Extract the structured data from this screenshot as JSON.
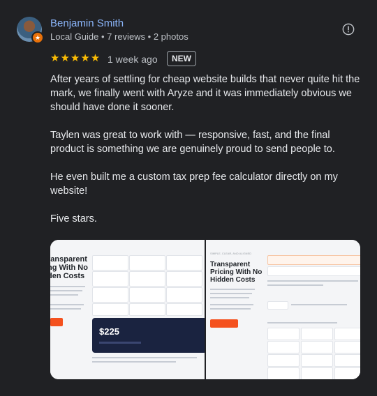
{
  "reviewer": {
    "name": "Benjamin Smith",
    "meta": "Local Guide • 7 reviews • 2 photos",
    "badge_icon": "local-guide-star-icon"
  },
  "rating": {
    "stars_text": "★★★★★",
    "value": 5,
    "date": "1 week ago",
    "badge": "NEW"
  },
  "review": {
    "paragraphs": [
      "After years of settling for cheap website builds that never quite hit the mark, we finally went with Aryze and it was immediately obvious we should have done it sooner.",
      "Taylen was great to work with — responsive, fast, and the final product is something we are genuinely proud to send people to.",
      "He even built me a custom tax prep fee calculator directly on my website!",
      "Five stars."
    ]
  },
  "photos": [
    {
      "heading_lines": [
        "ransparent",
        "ng With No",
        "den Costs"
      ],
      "price": "$225"
    },
    {
      "eyebrow": "SIMPLE, CLEAR, AND ALIGNED",
      "heading_lines": [
        "Transparent",
        "Pricing With No",
        "Hidden Costs"
      ]
    }
  ],
  "colors": {
    "background": "#202124",
    "name": "#8ab4f8",
    "stars": "#fbbc04",
    "cta": "#f4511e"
  }
}
